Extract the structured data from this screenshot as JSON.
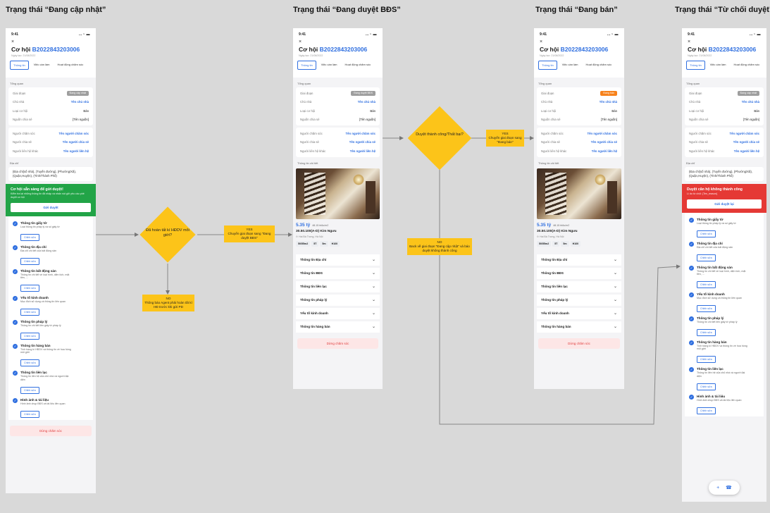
{
  "columns": [
    {
      "title": "Trạng thái “Đang cập nhật”"
    },
    {
      "title": "Trạng thái “Đang duyệt BĐS”"
    },
    {
      "title": "Trạng thái “Đang bán”"
    },
    {
      "title": "Trạng thái “Từ chối duyệt”"
    }
  ],
  "phone": {
    "time": "9:41",
    "signal": "…◔ ▬",
    "close": "×",
    "title_prefix": "Cơ hội",
    "code": "B2022843203006",
    "date": "Ngày tạo: 21/08/2022",
    "tabs": [
      "Thông tin",
      "Việc cần làm",
      "Hoạt động chăm sóc"
    ],
    "overview_label": "Tổng quan",
    "rows": {
      "stage": "Giai đoạn",
      "owner": "Chủ nhà",
      "owner_val": "Tên chủ nhà",
      "type": "Loại cơ hội",
      "type_val": "Bán",
      "source": "Nguồn chia sẻ",
      "source_val": "[Tên nguồn]",
      "carer": "Người chăm sóc",
      "carer_val": "Tên người chăm sóc",
      "sharer": "Người chia sẻ",
      "sharer_val": "Tên người chia sẻ",
      "contact": "Người liên hệ khác",
      "contact_val": "Tên người liên hệ"
    },
    "address_label": "Địa chỉ",
    "address": "{Địa chỉ(số nhà), (Tuyến đường), (Phường/Xã), (Quận,Huyện), (Tỉnh/Thành Phố)",
    "detail_label": "Thông tin chi tiết",
    "stop_label": "Dừng chăm sóc"
  },
  "badges": {
    "updating": "Đang cập nhật",
    "reviewing": "Đang duyệt BĐS",
    "selling": "Đang bán",
    "rejected": "Đang cập nhật"
  },
  "colors": {
    "accent": "#2f6fe0",
    "ready_banner": "#22a447",
    "reject_banner": "#e53935",
    "diamond": "#fcc419",
    "badge_gray": "#9e9e9e",
    "badge_orange": "#f7821b"
  },
  "banner_ready": {
    "title": "Cơ hội sẵn sàng để gửi duyệt!",
    "sub": "Kiểm tra lại những thông tin đã nhập và nhấn nút gửi yêu cầu phê duyệt cơ hội",
    "button": "Gửi duyệt"
  },
  "banner_reject": {
    "title": "Duyệt căn hộ không thành công",
    "sub": "Lí do từ chối: {Ten_reason}",
    "button": "Gửi duyệt lại"
  },
  "checklist": [
    {
      "title": "Thông tin giấy tờ",
      "desc": "Loại thông tin pháp lý và số giấy tờ",
      "btn": "Chỉnh sửa"
    },
    {
      "title": "Thông tin địa chỉ",
      "desc": "Địa chỉ chi tiết của bất động sản",
      "btn": "Chỉnh sửa"
    },
    {
      "title": "Thông tin bất động sản",
      "desc": "Thông tin chi tiết về loại hình, diện tích, mặt tiền, ...",
      "btn": "Chỉnh sửa"
    },
    {
      "title": "Yếu tố kinh doanh",
      "desc": "Mục đích sử dụng và thông tin liên quan",
      "btn": "Chỉnh sửa"
    },
    {
      "title": "Thông tin pháp lý",
      "desc": "Thông tin chi tiết liên giấy tờ pháp lý",
      "btn": "Chỉnh sửa"
    },
    {
      "title": "Thông tin hàng bán",
      "desc": "Tình trạng kí HĐDV và thông tin về hoa hồng môi giới",
      "btn": "Chỉnh sửa"
    },
    {
      "title": "Thông tin liên lạc",
      "desc": "Thông tin liên hệ của chủ nhà và người đại diện",
      "btn": "Chỉnh sửa"
    },
    {
      "title": "Hình ảnh & tài liệu",
      "desc": "Hình ảnh chụp BĐS và tài liệu liên quan",
      "btn": "Chỉnh sửa"
    }
  ],
  "listing": {
    "price": "5.35 tỷ",
    "per_m2": "48.15 triệu/m2",
    "title": "30.50.100(A-D) Kim Ngưu",
    "location": "Hai Bà Trưng, Hà Nội",
    "tags": [
      "50/55m2",
      "5T",
      "5m",
      "H100"
    ]
  },
  "accordion": [
    "Thông tin Địa chỉ",
    "Thông tin BĐS",
    "Thông tin liên lạc",
    "Thông tin pháp lý",
    "Yếu tố kinh doanh",
    "Thông tin hàng bán"
  ],
  "flow": {
    "d1": "Đã hoàn tất kí HĐDV môi giới?",
    "d1_yes": "YES\nChuyển giai đoạn sang \"Đang duyệt BĐS\"",
    "d1_no": "NO\nThông báo Agent phải hoàn tất kí HĐ trước khi gửi PD",
    "d2": "Duyệt thành công/Thất bại?",
    "d2_yes": "YES\nChuyển giai đoạn sang \"Đang bán\"",
    "d2_no": "NO\nBack về giai đoạn \"Đang cập nhật\" và báo duyệt không thành công"
  },
  "fab": {
    "plus": "+",
    "phone": "☎"
  }
}
